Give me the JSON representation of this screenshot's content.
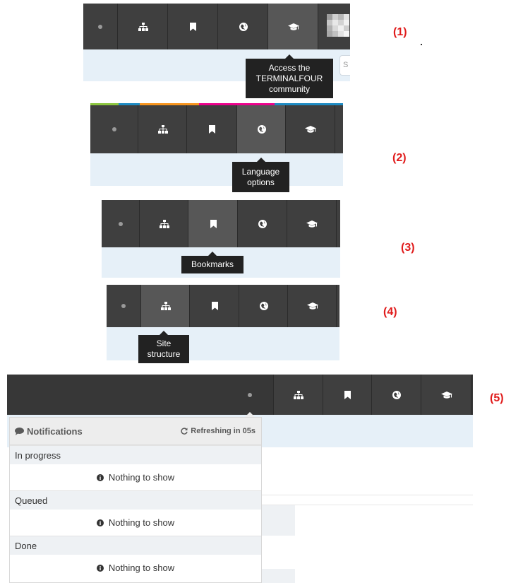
{
  "labels": [
    "(1)",
    "(2)",
    "(3)",
    "(4)",
    "(5)"
  ],
  "tooltips": {
    "community": "Access the\nTERMINALFOUR\ncommunity",
    "language": "Language\noptions",
    "bookmarks": "Bookmarks",
    "site_structure": "Site\nstructure"
  },
  "icons": {
    "status": "status-dot-icon",
    "site_structure": "sitemap-icon",
    "bookmarks": "bookmark-icon",
    "language": "globe-icon",
    "community": "graduation-cap-icon"
  },
  "colors": {
    "toolbar": "#3f3f3f",
    "active_cell": "#575757",
    "subbar": "#e6f0f8",
    "tooltip": "#222222",
    "label": "#e01b1b",
    "color_strip": [
      "#8cc63f",
      "#1e8bc3",
      "#f7941d",
      "#ec008c",
      "#1e8bc3"
    ]
  },
  "notifications": {
    "title": "Notifications",
    "refresh": "Refreshing in 05s",
    "sections": [
      {
        "name": "In progress",
        "empty": "Nothing to show"
      },
      {
        "name": "Queued",
        "empty": "Nothing to show"
      },
      {
        "name": "Done",
        "empty": "Nothing to show"
      }
    ]
  },
  "subbar_hint": "S"
}
